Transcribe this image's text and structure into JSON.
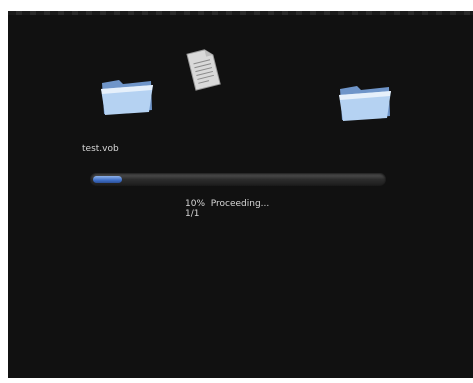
{
  "dialog": {
    "source_icon": "folder-icon",
    "destination_icon": "folder-icon",
    "file_icon": "document-icon",
    "filename": "test.vob",
    "progress": {
      "percent": 10,
      "percent_label": "10%",
      "status_text": "Proceeding...",
      "count_text": "1/1"
    }
  },
  "colors": {
    "background": "#111111",
    "folder_blue": "#a8c8ee",
    "progress_blue": "#3f6fc7",
    "text": "#d8d8d8"
  }
}
